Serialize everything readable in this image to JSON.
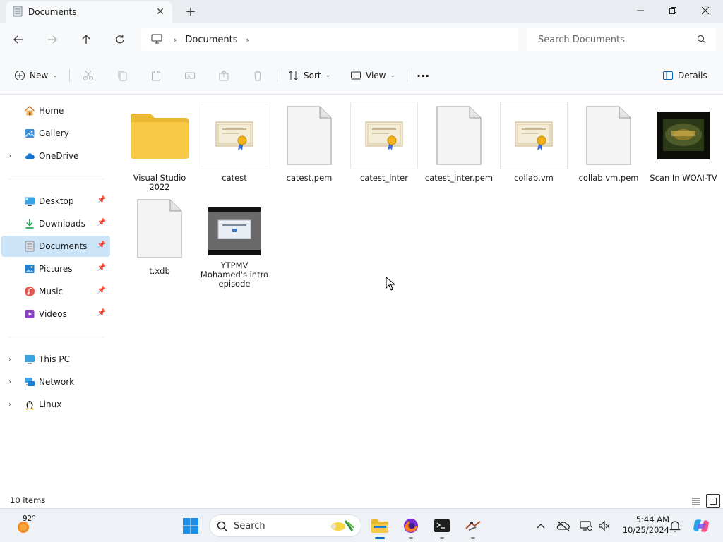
{
  "window": {
    "tab_title": "Documents",
    "new_tab_symbol": "+"
  },
  "navigation": {
    "breadcrumb": [
      "Documents"
    ],
    "search_placeholder": "Search Documents"
  },
  "command_bar": {
    "new_label": "New",
    "sort_label": "Sort",
    "view_label": "View",
    "more_label": "···",
    "details_label": "Details"
  },
  "sidebar": {
    "top_items": [
      {
        "label": "Home",
        "icon": "home-icon"
      },
      {
        "label": "Gallery",
        "icon": "gallery-icon"
      },
      {
        "label": "OneDrive",
        "icon": "cloud-icon"
      }
    ],
    "quick_access": [
      {
        "label": "Desktop",
        "icon": "desktop-icon",
        "pinned": true
      },
      {
        "label": "Downloads",
        "icon": "download-icon",
        "pinned": true
      },
      {
        "label": "Documents",
        "icon": "documents-icon",
        "pinned": true,
        "selected": true
      },
      {
        "label": "Pictures",
        "icon": "pictures-icon",
        "pinned": true
      },
      {
        "label": "Music",
        "icon": "music-icon",
        "pinned": true
      },
      {
        "label": "Videos",
        "icon": "videos-icon",
        "pinned": true
      }
    ],
    "bottom_items": [
      {
        "label": "This PC",
        "icon": "pc-icon"
      },
      {
        "label": "Network",
        "icon": "network-icon"
      },
      {
        "label": "Linux",
        "icon": "linux-icon"
      }
    ]
  },
  "files": [
    {
      "name": "Visual Studio 2022",
      "type": "folder"
    },
    {
      "name": "catest",
      "type": "certificate"
    },
    {
      "name": "catest.pem",
      "type": "document"
    },
    {
      "name": "catest_inter",
      "type": "certificate"
    },
    {
      "name": "catest_inter.pem",
      "type": "document"
    },
    {
      "name": "collab.vm",
      "type": "certificate"
    },
    {
      "name": "collab.vm.pem",
      "type": "document"
    },
    {
      "name": "Scan In WOAI-TV",
      "type": "video"
    },
    {
      "name": "t.xdb",
      "type": "document"
    },
    {
      "name": "YTPMV Mohamed's intro episode",
      "type": "video"
    }
  ],
  "status": {
    "item_count": "10 items"
  },
  "taskbar": {
    "weather_temp": "92°",
    "search_label": "Search",
    "time": "5:44 AM",
    "date": "10/25/2024",
    "colors": {
      "accent": "#0067c0",
      "selection": "#cce4f7",
      "folder": "#f8c944"
    }
  }
}
